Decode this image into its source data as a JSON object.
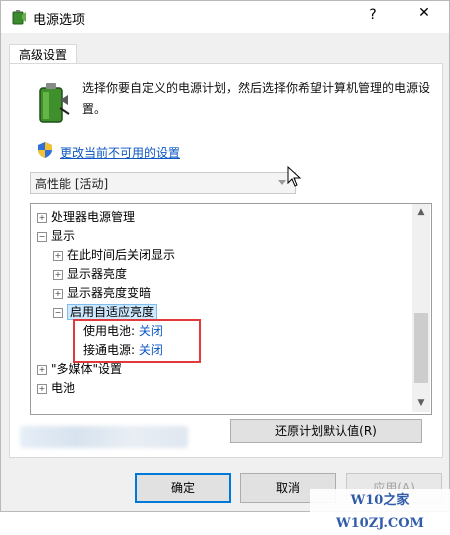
{
  "window": {
    "title": "电源选项",
    "help_glyph": "?",
    "close_glyph": "✕"
  },
  "tabs": [
    {
      "label": "高级设置",
      "selected": true
    }
  ],
  "content": {
    "description": "选择你要自定义的电源计划，然后选择你希望计算机管理的电源设置。",
    "change_link": "更改当前不可用的设置",
    "plan_select": {
      "value": "高性能 [活动]"
    }
  },
  "tree": {
    "items": [
      {
        "label": "处理器电源管理",
        "expander": "+"
      },
      {
        "label": "显示",
        "expander": "−"
      },
      {
        "label": "在此时间后关闭显示",
        "expander": "+"
      },
      {
        "label": "显示器亮度",
        "expander": "+"
      },
      {
        "label": "显示器亮度变暗",
        "expander": "+"
      },
      {
        "label": "启用自适应亮度",
        "expander": "−",
        "selected": true
      },
      {
        "label": "使用电池:",
        "value": "关闭"
      },
      {
        "label": "接通电源:",
        "value": "关闭"
      },
      {
        "label": "\"多媒体\"设置",
        "expander": "+"
      },
      {
        "label": "电池",
        "expander": "+"
      }
    ],
    "scroll_up_glyph": "▲",
    "scroll_down_glyph": "▼"
  },
  "buttons": {
    "restore": "还原计划默认值(R)",
    "ok": "确定",
    "cancel": "取消",
    "apply": "应用(A)"
  },
  "watermark": "W10之家 W10ZJ.COM",
  "colors": {
    "link": "#0b56c3",
    "highlight_box": "#e23a3a",
    "selection": "#cde8ff"
  }
}
